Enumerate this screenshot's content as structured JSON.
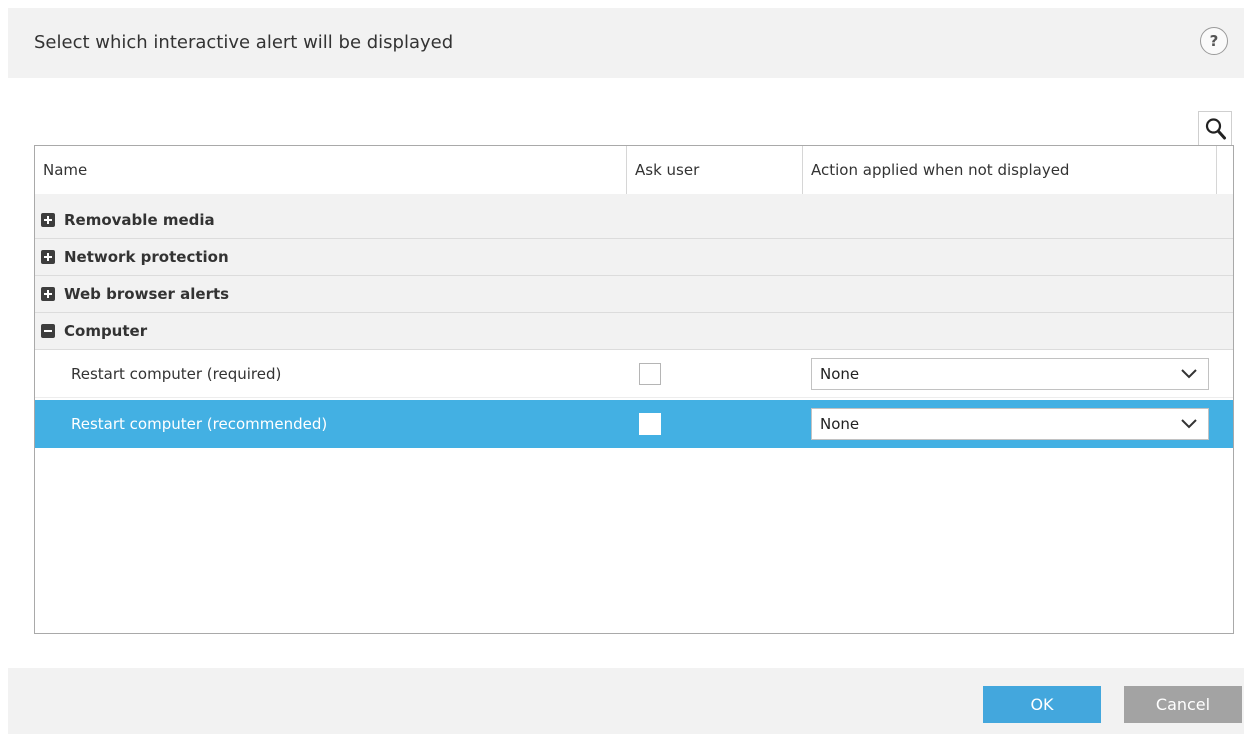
{
  "dialog": {
    "title": "Select which interactive alert will be displayed",
    "help_label": "?"
  },
  "table": {
    "columns": [
      "Name",
      "Ask user",
      "Action applied when not displayed"
    ],
    "groups": [
      {
        "label": "Removable media",
        "expanded": false
      },
      {
        "label": "Network protection",
        "expanded": false
      },
      {
        "label": "Web browser alerts",
        "expanded": false
      },
      {
        "label": "Computer",
        "expanded": true
      }
    ],
    "rows": [
      {
        "name": "Restart computer (required)",
        "ask_user": false,
        "action": "None",
        "selected": false
      },
      {
        "name": "Restart computer (recommended)",
        "ask_user": false,
        "action": "None",
        "selected": true
      }
    ]
  },
  "footer": {
    "ok_label": "OK",
    "cancel_label": "Cancel"
  },
  "colors": {
    "accent": "#43b0e3",
    "ok_button": "#43a7dd",
    "cancel_button": "#a3a3a3",
    "header_bg": "#f2f2f2"
  },
  "icons": {
    "help": "help-icon",
    "search": "search-icon",
    "expand": "plus-square-icon",
    "collapse": "minus-square-icon",
    "dropdown": "chevron-down-icon"
  }
}
